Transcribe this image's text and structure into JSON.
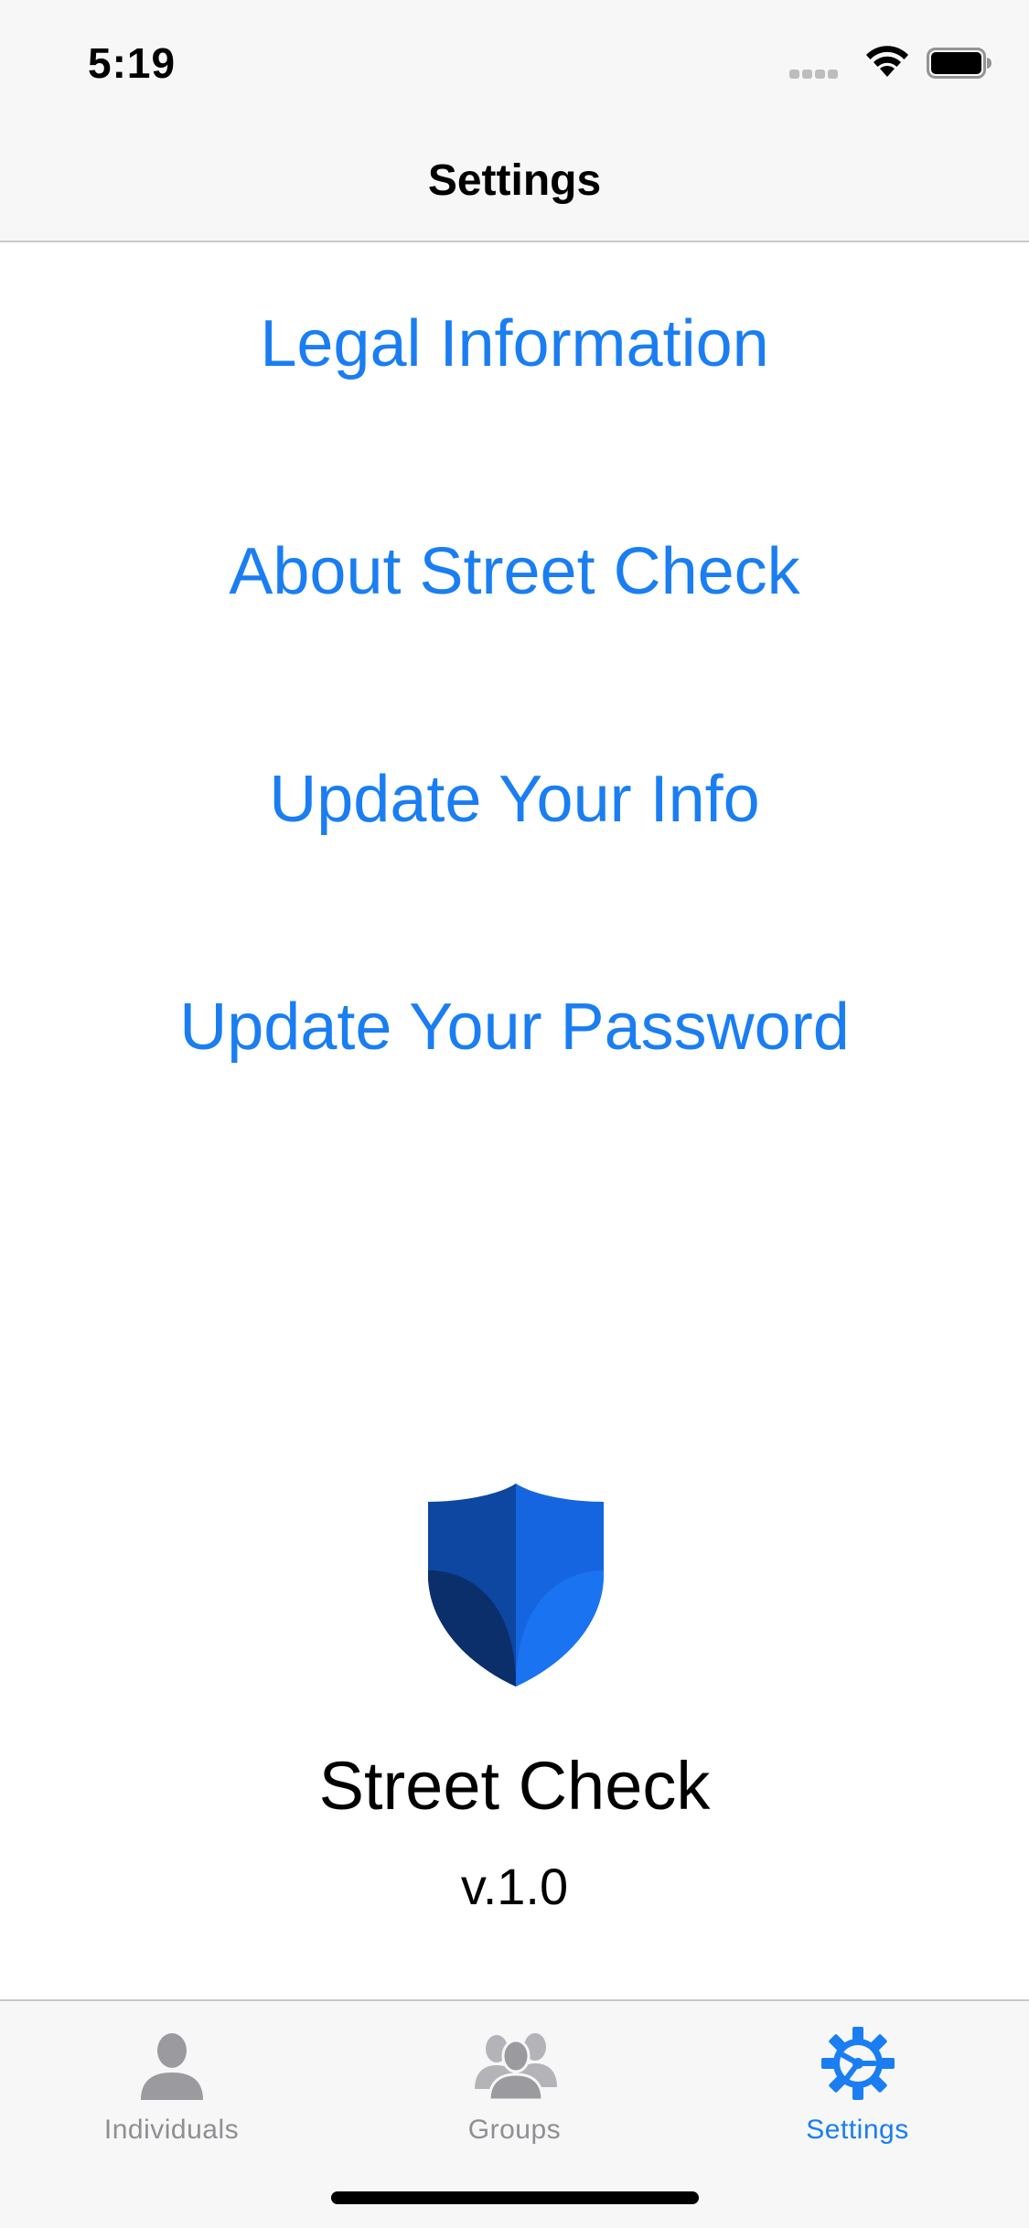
{
  "status_bar": {
    "time": "5:19",
    "icons": [
      "signal-icon",
      "wifi-icon",
      "battery-icon"
    ]
  },
  "nav": {
    "title": "Settings"
  },
  "menu": {
    "items": [
      {
        "label": "Legal Information"
      },
      {
        "label": "About Street Check"
      },
      {
        "label": "Update Your Info"
      },
      {
        "label": "Update Your Password"
      }
    ]
  },
  "branding": {
    "app_name": "Street Check",
    "version": "v.1.0",
    "logo_icon": "shield-icon"
  },
  "tab_bar": {
    "tabs": [
      {
        "label": "Individuals",
        "icon": "person-icon",
        "active": false
      },
      {
        "label": "Groups",
        "icon": "group-icon",
        "active": false
      },
      {
        "label": "Settings",
        "icon": "gear-icon",
        "active": true
      }
    ]
  },
  "colors": {
    "accent": "#1a7ef2",
    "inactive": "#8e8e93",
    "bar_background": "#f7f7f7",
    "shield_dark": "#0b2f6b",
    "shield_mid": "#0d47a1",
    "shield_light": "#1565e0"
  }
}
